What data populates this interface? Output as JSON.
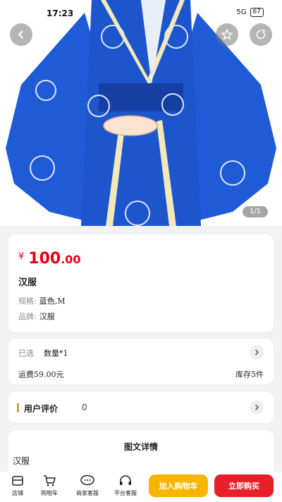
{
  "status_bar": {
    "time": "17:23",
    "signal_text": "5G",
    "battery": "67"
  },
  "gallery": {
    "counter": "1/1"
  },
  "product": {
    "currency": "¥",
    "price_int": "100",
    "price_dec": ".00",
    "name": "汉服",
    "spec_label": "规格:",
    "spec_value": "蓝色,M",
    "brand_label": "品牌:",
    "brand_value": "汉服"
  },
  "selection": {
    "selected_label": "已选",
    "quantity_text": "数量*1",
    "freight_text": "运费59.00元",
    "stock_text": "库存5件"
  },
  "reviews": {
    "label": "用户评价",
    "count": "0"
  },
  "detail": {
    "title": "图文详情",
    "text": "汉服"
  },
  "bottom_bar": {
    "store_label": "店铺",
    "cart_label": "购物车",
    "merchant_service_label": "商家客服",
    "platform_service_label": "平台客服",
    "add_to_cart_label": "加入购物车",
    "buy_now_label": "立即购买"
  },
  "colors": {
    "price": "#e60012",
    "add_to_cart": "#f7b500",
    "buy_now": "#e8202a",
    "robe": "#1f5bd6"
  }
}
